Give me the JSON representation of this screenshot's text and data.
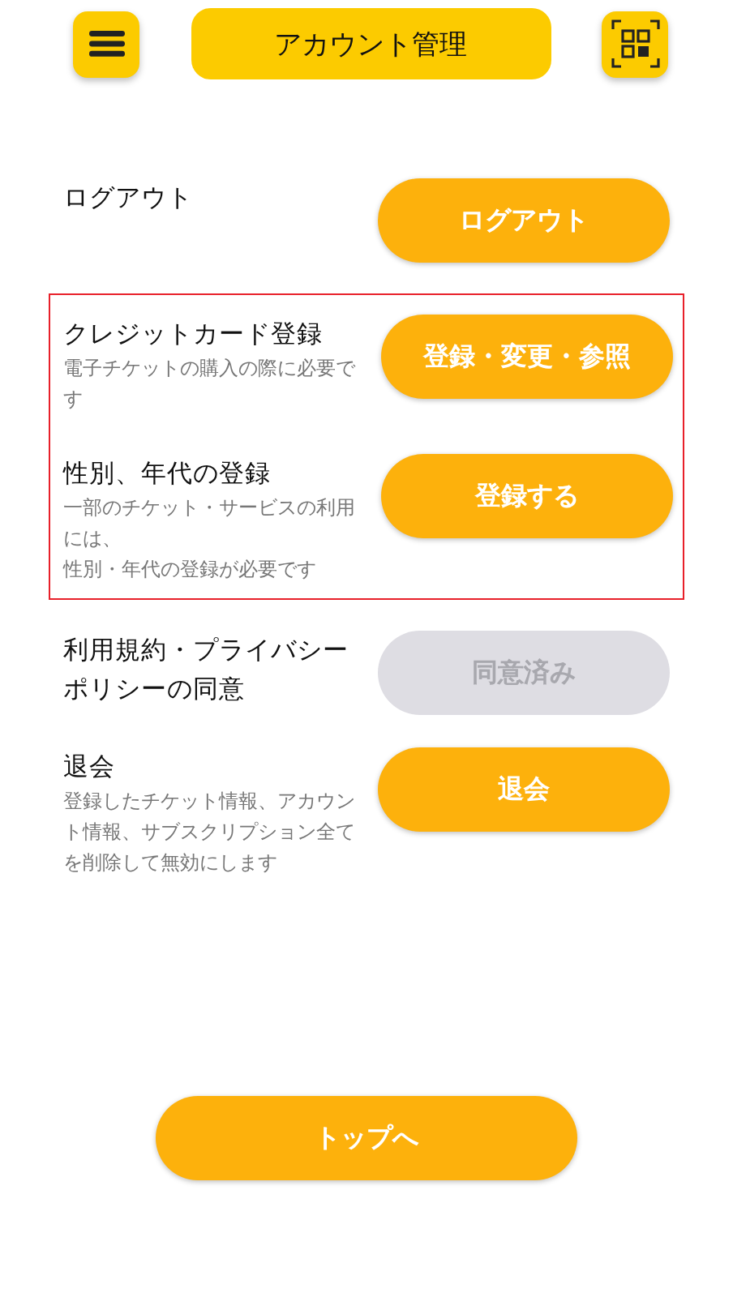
{
  "header": {
    "title": "アカウント管理"
  },
  "groups": [
    {
      "highlighted": false,
      "rows": [
        {
          "title": "ログアウト",
          "button": {
            "label": "ログアウト",
            "disabled": false
          }
        }
      ]
    },
    {
      "highlighted": true,
      "rows": [
        {
          "title": "クレジットカード登録",
          "description": [
            "電子チケットの購入の際に必要です"
          ],
          "button": {
            "label": "登録・変更・参照",
            "disabled": false
          }
        },
        {
          "title": "性別、年代の登録",
          "description": [
            "一部のチケット・サービスの利用には、",
            "性別・年代の登録が必要です"
          ],
          "button": {
            "label": "登録する",
            "disabled": false
          }
        }
      ]
    },
    {
      "highlighted": false,
      "rows": [
        {
          "title": "利用規約・プライバシーポリシーの同意",
          "button": {
            "label": "同意済み",
            "disabled": true
          }
        }
      ]
    },
    {
      "highlighted": false,
      "rows": [
        {
          "title": "退会",
          "description": [
            "登録したチケット情報、アカウント情報、サブスクリプション全てを削除して無効にします"
          ],
          "button": {
            "label": "退会",
            "disabled": false
          }
        }
      ]
    }
  ],
  "footer_button": {
    "label": "トップへ"
  }
}
